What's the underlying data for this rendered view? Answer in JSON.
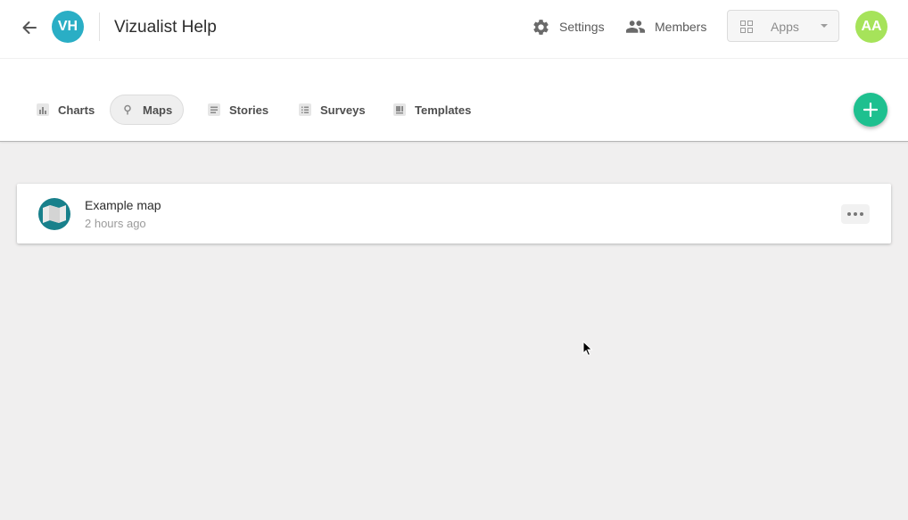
{
  "header": {
    "team_initials": "VH",
    "team_name": "Vizualist Help",
    "settings_label": "Settings",
    "members_label": "Members",
    "apps_label": "Apps",
    "user_initials": "AA"
  },
  "tabs": [
    {
      "label": "Charts",
      "icon": "bar-chart-icon",
      "active": false
    },
    {
      "label": "Maps",
      "icon": "map-pin-icon",
      "active": true
    },
    {
      "label": "Stories",
      "icon": "document-icon",
      "active": false
    },
    {
      "label": "Surveys",
      "icon": "list-icon",
      "active": false
    },
    {
      "label": "Templates",
      "icon": "template-icon",
      "active": false
    }
  ],
  "items": [
    {
      "title": "Example map",
      "time": "2 hours ago",
      "icon": "map-icon"
    }
  ],
  "colors": {
    "team_avatar": "#2aaec5",
    "user_avatar": "#a6e35a",
    "fab": "#1ec08f",
    "map_icon_bg": "#18808b"
  }
}
